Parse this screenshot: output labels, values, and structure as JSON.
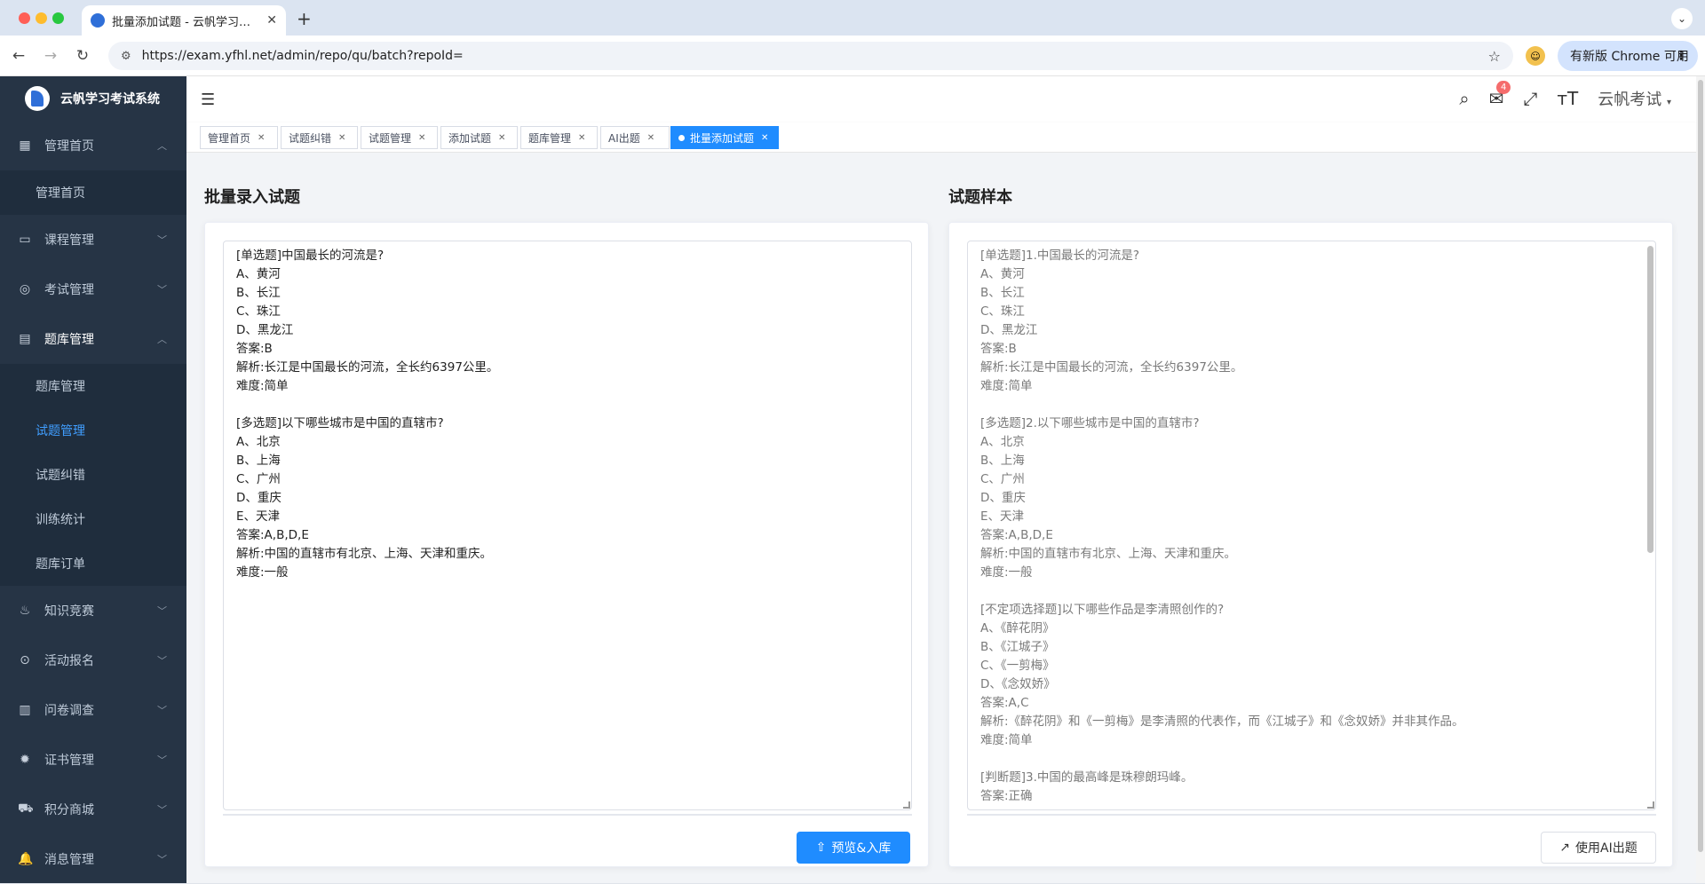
{
  "browser": {
    "tab_title": "批量添加试题 - 云帆学习考试系",
    "url": "https://exam.yfhl.net/admin/repo/qu/batch?repoId=",
    "update_label": "有新版 Chrome 可用"
  },
  "sidebar": {
    "app_name": "云帆学习考试系统",
    "groups": [
      {
        "label": "管理首页",
        "icon": "dashboard-icon",
        "items": [
          "管理首页"
        ]
      },
      {
        "label": "课程管理",
        "icon": "monitor-icon"
      },
      {
        "label": "考试管理",
        "icon": "target-icon"
      },
      {
        "label": "题库管理",
        "icon": "document-icon",
        "items": [
          "题库管理",
          "试题管理",
          "试题纠错",
          "训练统计",
          "题库订单"
        ]
      },
      {
        "label": "知识竞赛",
        "icon": "fire-icon"
      },
      {
        "label": "活动报名",
        "icon": "circle-icon"
      },
      {
        "label": "问卷调查",
        "icon": "book-icon"
      },
      {
        "label": "证书管理",
        "icon": "badge-icon"
      },
      {
        "label": "积分商城",
        "icon": "cart-icon"
      },
      {
        "label": "消息管理",
        "icon": "bell-icon"
      }
    ],
    "active_item": "试题管理"
  },
  "header": {
    "notification_count": "4",
    "user_name": "云帆考试"
  },
  "tags": [
    {
      "label": "管理首页"
    },
    {
      "label": "试题纠错"
    },
    {
      "label": "试题管理"
    },
    {
      "label": "添加试题"
    },
    {
      "label": "题库管理"
    },
    {
      "label": "AI出题"
    },
    {
      "label": "批量添加试题",
      "active": true
    }
  ],
  "left": {
    "title": "批量录入试题",
    "content": "[单选题]中国最长的河流是?\nA、黄河\nB、长江\nC、珠江\nD、黑龙江\n答案:B\n解析:长江是中国最长的河流，全长约6397公里。\n难度:简单\n\n[多选题]以下哪些城市是中国的直辖市?\nA、北京\nB、上海\nC、广州\nD、重庆\nE、天津\n答案:A,B,D,E\n解析:中国的直辖市有北京、上海、天津和重庆。\n难度:一般",
    "button": "预览&入库"
  },
  "right": {
    "title": "试题样本",
    "content": "[单选题]1.中国最长的河流是?\nA、黄河\nB、长江\nC、珠江\nD、黑龙江\n答案:B\n解析:长江是中国最长的河流，全长约6397公里。\n难度:简单\n\n[多选题]2.以下哪些城市是中国的直辖市?\nA、北京\nB、上海\nC、广州\nD、重庆\nE、天津\n答案:A,B,D,E\n解析:中国的直辖市有北京、上海、天津和重庆。\n难度:一般\n\n[不定项选择题]以下哪些作品是李清照创作的?\nA、《醉花阴》\nB、《江城子》\nC、《一剪梅》\nD、《念奴娇》\n答案:A,C\n解析:《醉花阴》和《一剪梅》是李清照的代表作，而《江城子》和《念奴娇》并非其作品。\n难度:简单\n\n[判断题]3.中国的最高峰是珠穆朗玛峰。\n答案:正确",
    "button": "使用AI出题"
  }
}
